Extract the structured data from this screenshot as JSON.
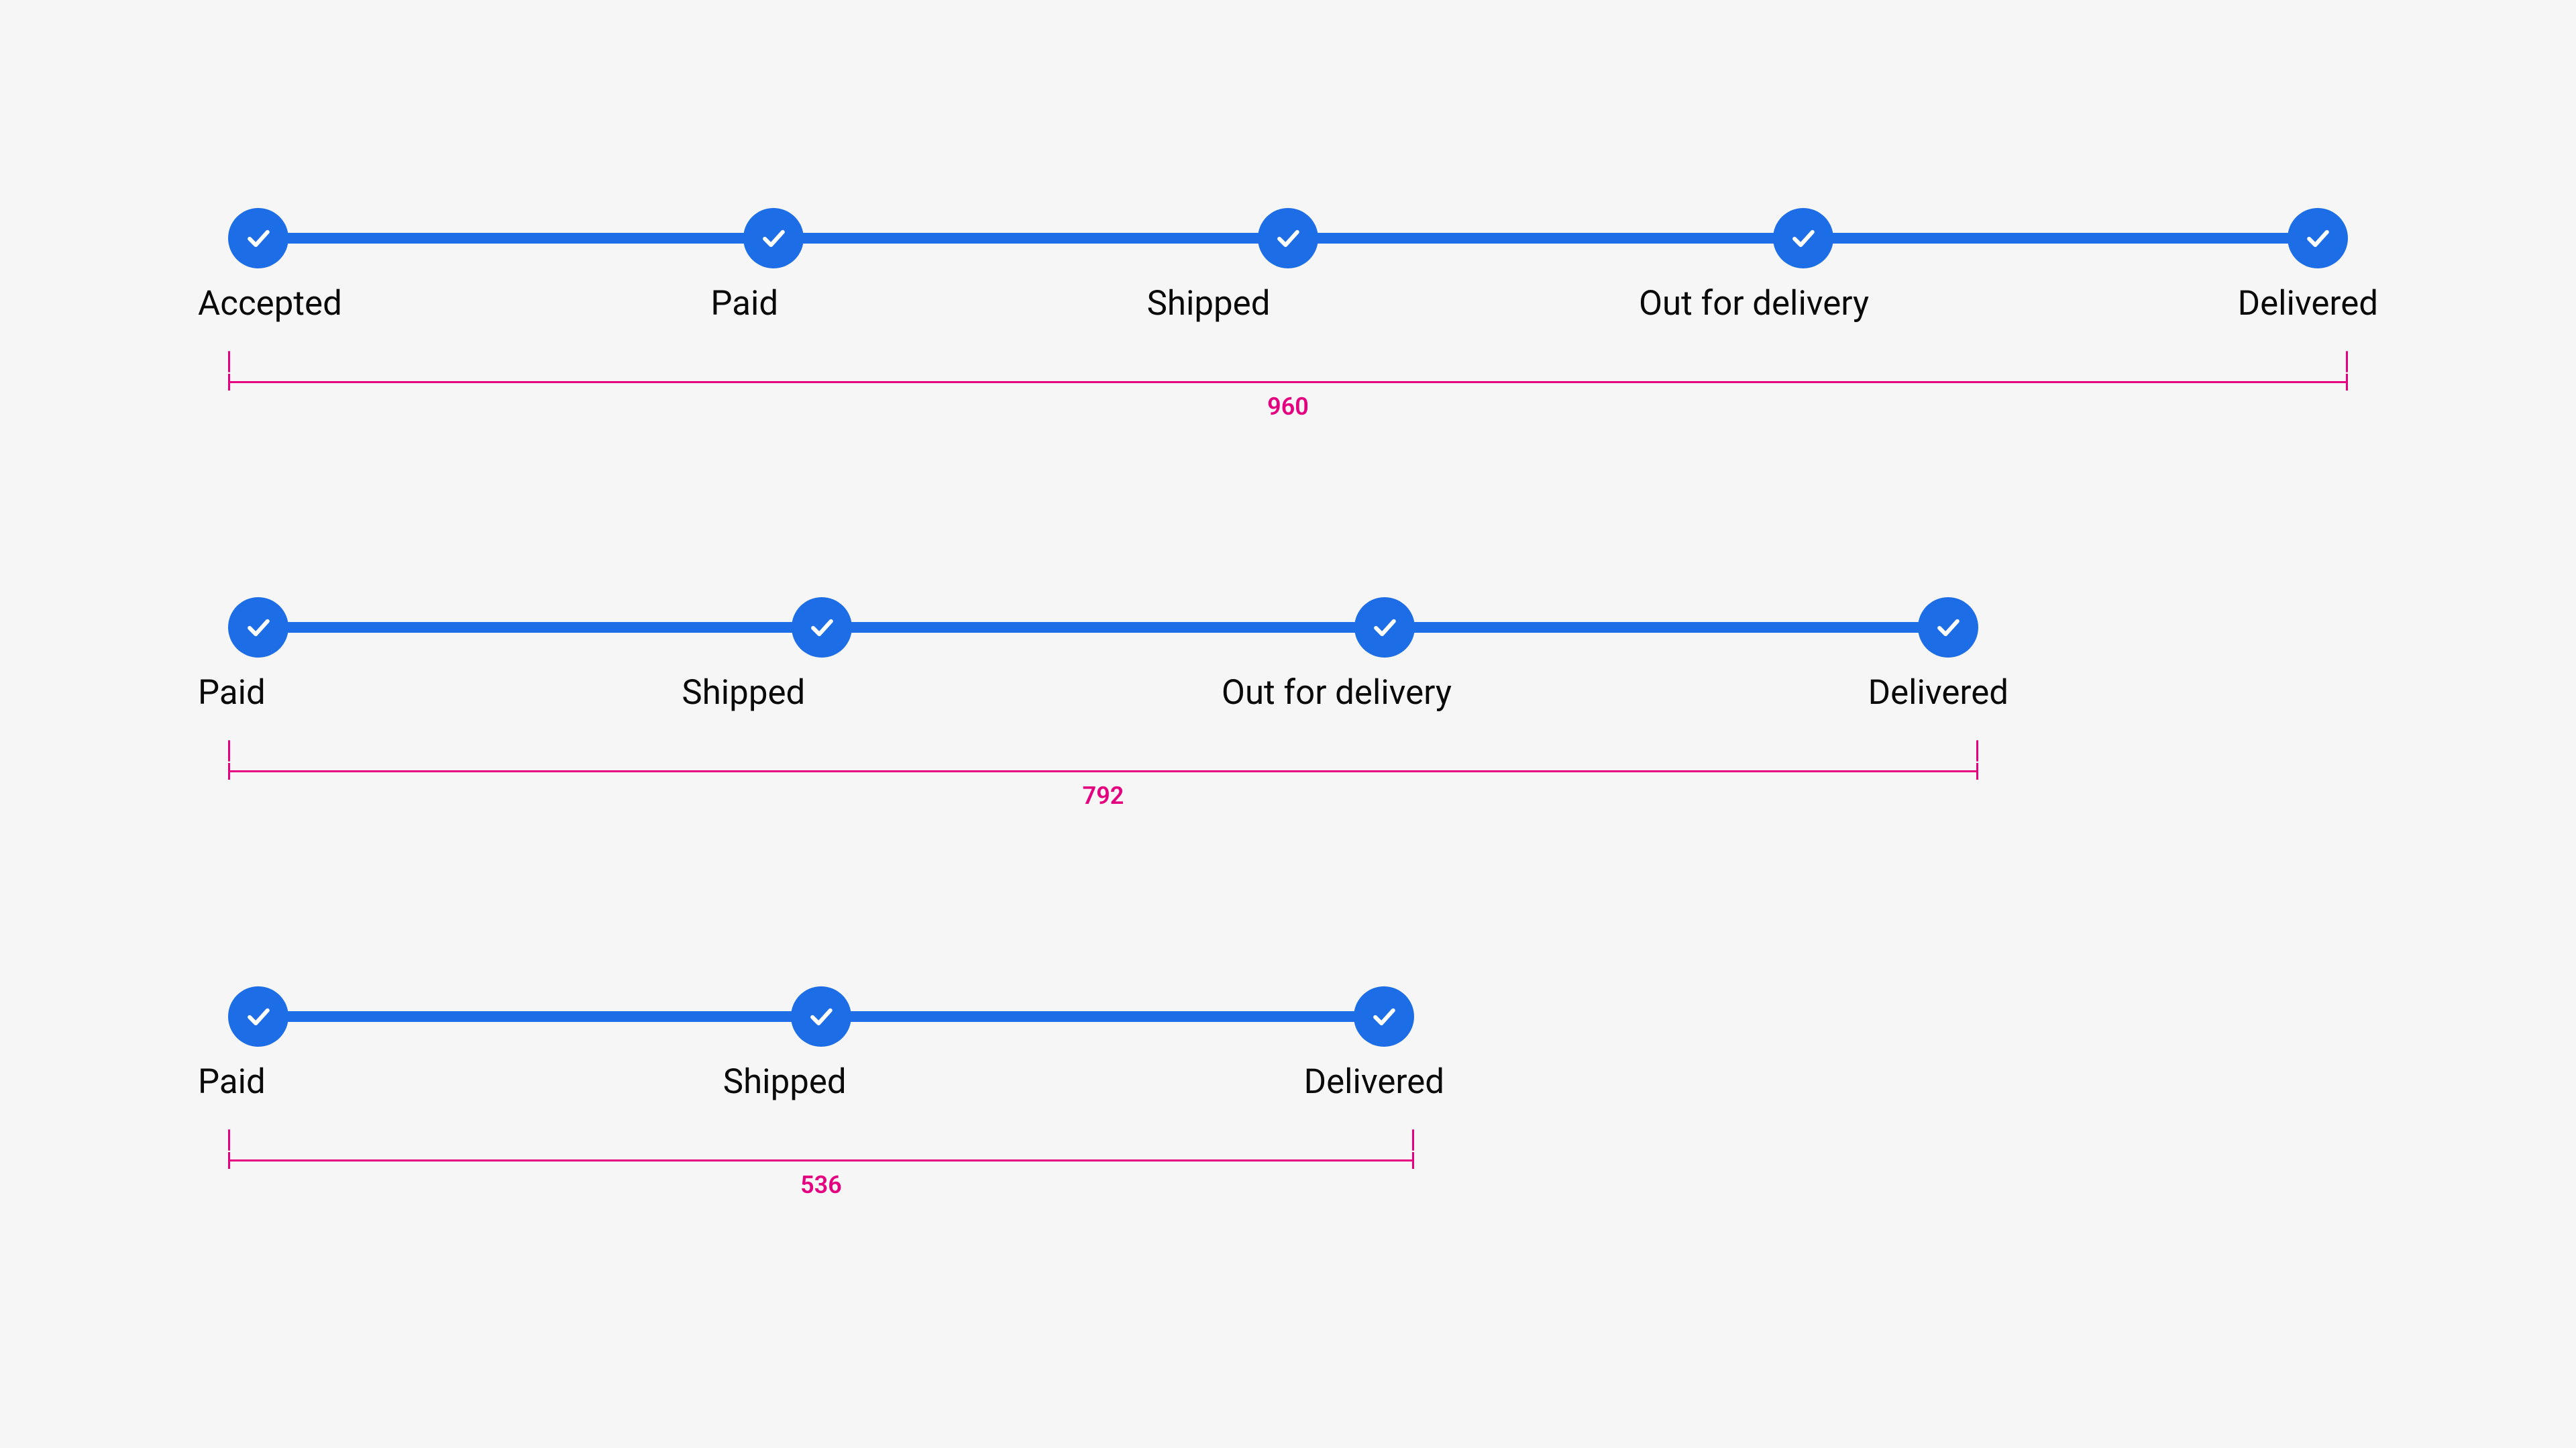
{
  "colors": {
    "accent": "#1d6ee6",
    "dimension": "#e4007f",
    "text": "#0a0a0a",
    "background": "#f6f6f6"
  },
  "icons": {
    "step": "check-icon"
  },
  "groups": [
    {
      "width_label": "960",
      "steps": [
        "Accepted",
        "Paid",
        "Shipped",
        "Out for delivery",
        "Delivered"
      ]
    },
    {
      "width_label": "792",
      "steps": [
        "Paid",
        "Shipped",
        "Out for delivery",
        "Delivered"
      ]
    },
    {
      "width_label": "536",
      "steps": [
        "Paid",
        "Shipped",
        "Delivered"
      ]
    }
  ]
}
